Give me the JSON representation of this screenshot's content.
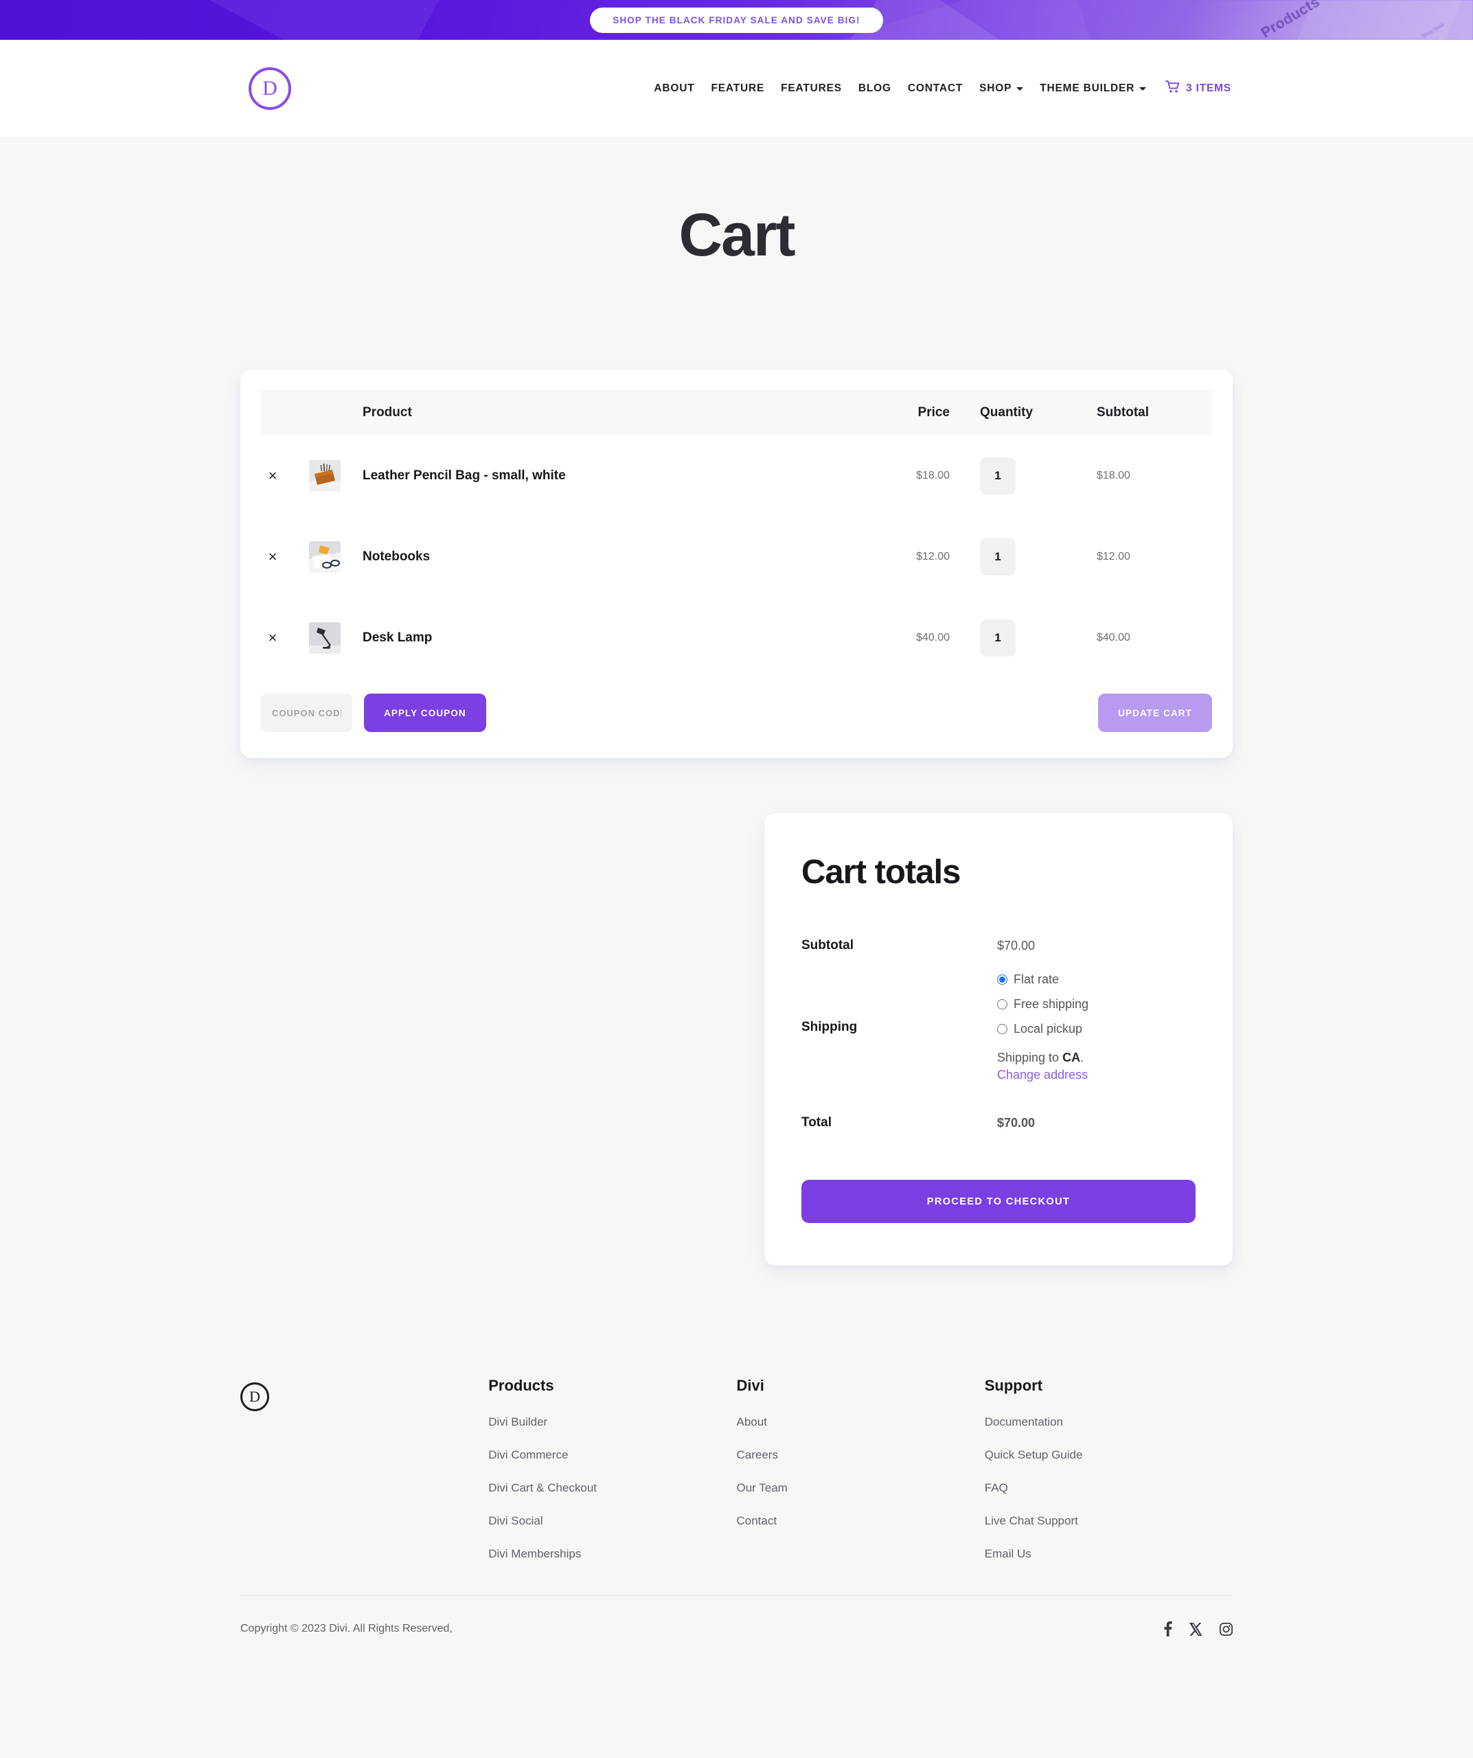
{
  "promo": {
    "button_label": "SHOP THE BLACK FRIDAY SALE AND SAVE BIG!",
    "bg_word": "Products",
    "bg_word_small": "Shop Now",
    "gradient_from": "#4f12d6",
    "gradient_to": "#9f7aec",
    "button_text_color": "#7b52e0"
  },
  "header": {
    "logo_letter": "D",
    "logo_color": "#8a4ce8",
    "nav": [
      {
        "label": "ABOUT",
        "has_caret": false
      },
      {
        "label": "FEATURE",
        "has_caret": false
      },
      {
        "label": "FEATURES",
        "has_caret": false
      },
      {
        "label": "BLOG",
        "has_caret": false
      },
      {
        "label": "CONTACT",
        "has_caret": false
      },
      {
        "label": "SHOP",
        "has_caret": true
      },
      {
        "label": "THEME BUILDER",
        "has_caret": true
      }
    ],
    "cart": {
      "icon": "shopping-cart-icon",
      "label": "3 ITEMS",
      "color": "#7a45e0"
    }
  },
  "page": {
    "title": "Cart"
  },
  "cart_table": {
    "columns": {
      "product": "Product",
      "price": "Price",
      "quantity": "Quantity",
      "subtotal": "Subtotal"
    },
    "remove_glyph": "×",
    "rows": [
      {
        "name": "Leather Pencil Bag - small, white",
        "price": "$18.00",
        "quantity": "1",
        "subtotal": "$18.00",
        "thumb": "leather-pencil-bag-thumbnail"
      },
      {
        "name": "Notebooks",
        "price": "$12.00",
        "quantity": "1",
        "subtotal": "$12.00",
        "thumb": "notebooks-thumbnail"
      },
      {
        "name": "Desk Lamp",
        "price": "$40.00",
        "quantity": "1",
        "subtotal": "$40.00",
        "thumb": "desk-lamp-thumbnail"
      }
    ]
  },
  "cart_actions": {
    "coupon_placeholder": "COUPON CODE",
    "coupon_value": "",
    "apply_label": "APPLY COUPON",
    "update_label": "UPDATE CART",
    "apply_color": "#7b3fe4",
    "update_color": "#b89af0"
  },
  "totals": {
    "title": "Cart totals",
    "subtotal_label": "Subtotal",
    "subtotal_value": "$70.00",
    "shipping_label": "Shipping",
    "shipping_options": [
      {
        "label": "Flat rate",
        "selected": true
      },
      {
        "label": "Free shipping",
        "selected": false
      },
      {
        "label": "Local pickup",
        "selected": false
      }
    ],
    "shipping_to_prefix": "Shipping to ",
    "shipping_to_region": "CA",
    "shipping_to_suffix": ".",
    "change_address_label": "Change address",
    "total_label": "Total",
    "total_value": "$70.00",
    "checkout_label": "PROCEED TO CHECKOUT",
    "checkout_color": "#7b3fe4",
    "radio_accent": "#1a73e8"
  },
  "footer": {
    "logo_letter": "D",
    "columns": [
      {
        "heading": "Products",
        "links": [
          "Divi Builder",
          "Divi Commerce",
          "Divi Cart & Checkout",
          "Divi Social",
          "Divi Memberships"
        ]
      },
      {
        "heading": "Divi",
        "links": [
          "About",
          "Careers",
          "Our Team",
          "Contact"
        ]
      },
      {
        "heading": "Support",
        "links": [
          "Documentation",
          "Quick Setup Guide",
          "FAQ",
          "Live Chat Support",
          "Email Us"
        ]
      }
    ],
    "copyright": "Copyright © 2023 Divi. All Rights Reserved,",
    "socials": [
      "facebook-icon",
      "x-twitter-icon",
      "instagram-icon"
    ]
  }
}
